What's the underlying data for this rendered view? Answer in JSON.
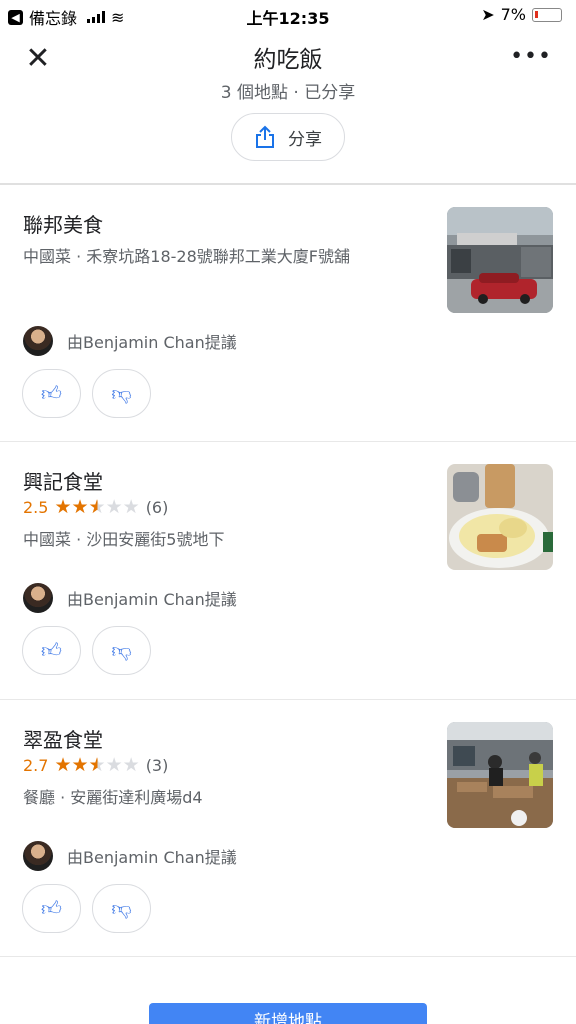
{
  "status_bar": {
    "back_app": "備忘錄",
    "time": "上午12:35",
    "battery": "7%"
  },
  "header": {
    "title": "約吃飯",
    "subtitle": "3 個地點 · 已分享",
    "share_label": "分享"
  },
  "places": [
    {
      "name": "聯邦美食",
      "description": "中國菜 · 禾寮坑路18-28號聯邦工業大廈F號舖",
      "suggested_by": "由Benjamin Chan提議"
    },
    {
      "name": "興記食堂",
      "rating": "2.5",
      "rating_value": 2.5,
      "review_count": "(6)",
      "description": "中國菜 · 沙田安麗街5號地下",
      "suggested_by": "由Benjamin Chan提議"
    },
    {
      "name": "翠盈食堂",
      "rating": "2.7",
      "rating_value": 2.7,
      "review_count": "(3)",
      "description": "餐廳 · 安麗街達利廣場d4",
      "suggested_by": "由Benjamin Chan提議"
    }
  ],
  "add_button": "新增地點",
  "colors": {
    "accent": "#4285f4",
    "rating": "#e37400",
    "thumb_icon": "#4a80e8"
  },
  "icons": [
    "close-icon",
    "more-icon",
    "share-icon",
    "thumbs-up-icon",
    "thumbs-down-icon"
  ]
}
